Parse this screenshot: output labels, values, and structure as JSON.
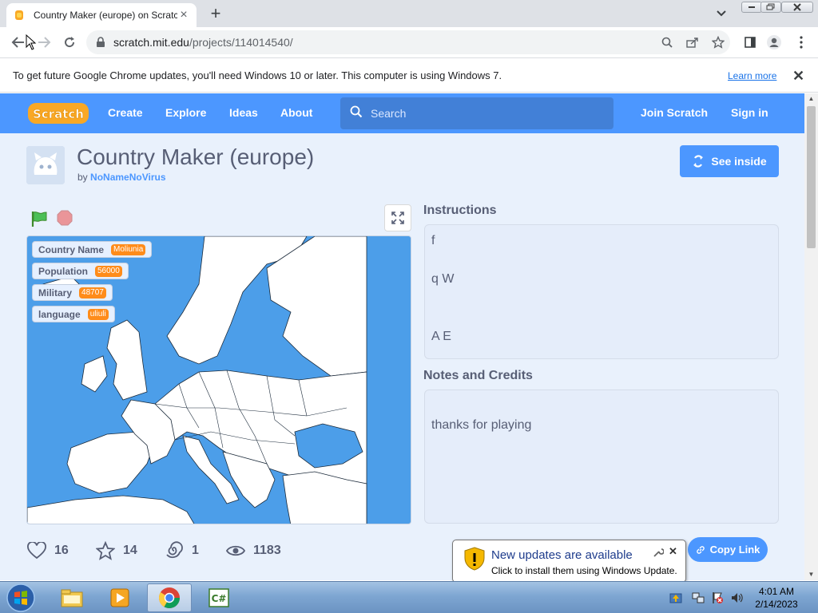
{
  "browser": {
    "tab_title": "Country Maker (europe) on Scratch",
    "url_host": "scratch.mit.edu",
    "url_path": "/projects/114014540/",
    "infobar_text": "To get future Google Chrome updates, you'll need Windows 10 or later. This computer is using Windows 7.",
    "infobar_link": "Learn more"
  },
  "scratch_nav": {
    "logo": "Scratch",
    "links": [
      "Create",
      "Explore",
      "Ideas",
      "About"
    ],
    "search_placeholder": "Search",
    "join": "Join Scratch",
    "sign_in": "Sign in"
  },
  "project": {
    "title": "Country Maker (europe)",
    "by_label": "by",
    "author": "NoNameNoVirus",
    "see_inside": "See inside",
    "monitors": [
      {
        "label": "Country Name",
        "value": "Moliunia"
      },
      {
        "label": "Population",
        "value": "56000"
      },
      {
        "label": "Military",
        "value": "48707"
      },
      {
        "label": "language",
        "value": "uliuli"
      }
    ],
    "instructions_title": "Instructions",
    "instructions_lines": [
      "f",
      "q W",
      "A E"
    ],
    "notes_title": "Notes and Credits",
    "notes_text": "thanks for playing",
    "stats": {
      "loves": "16",
      "favorites": "14",
      "remixes": "1",
      "views": "1183"
    },
    "copy_link": "Copy Link"
  },
  "balloon": {
    "title": "New updates are available",
    "text": "Click to install them using Windows Update."
  },
  "taskbar": {
    "time": "4:01 AM",
    "date": "2/14/2023"
  },
  "colors": {
    "scratch_blue": "#4c97ff",
    "monitor_orange": "#ff8c1a",
    "page_bg": "#e9f1fc",
    "stage_sea": "#4c9ee9"
  }
}
